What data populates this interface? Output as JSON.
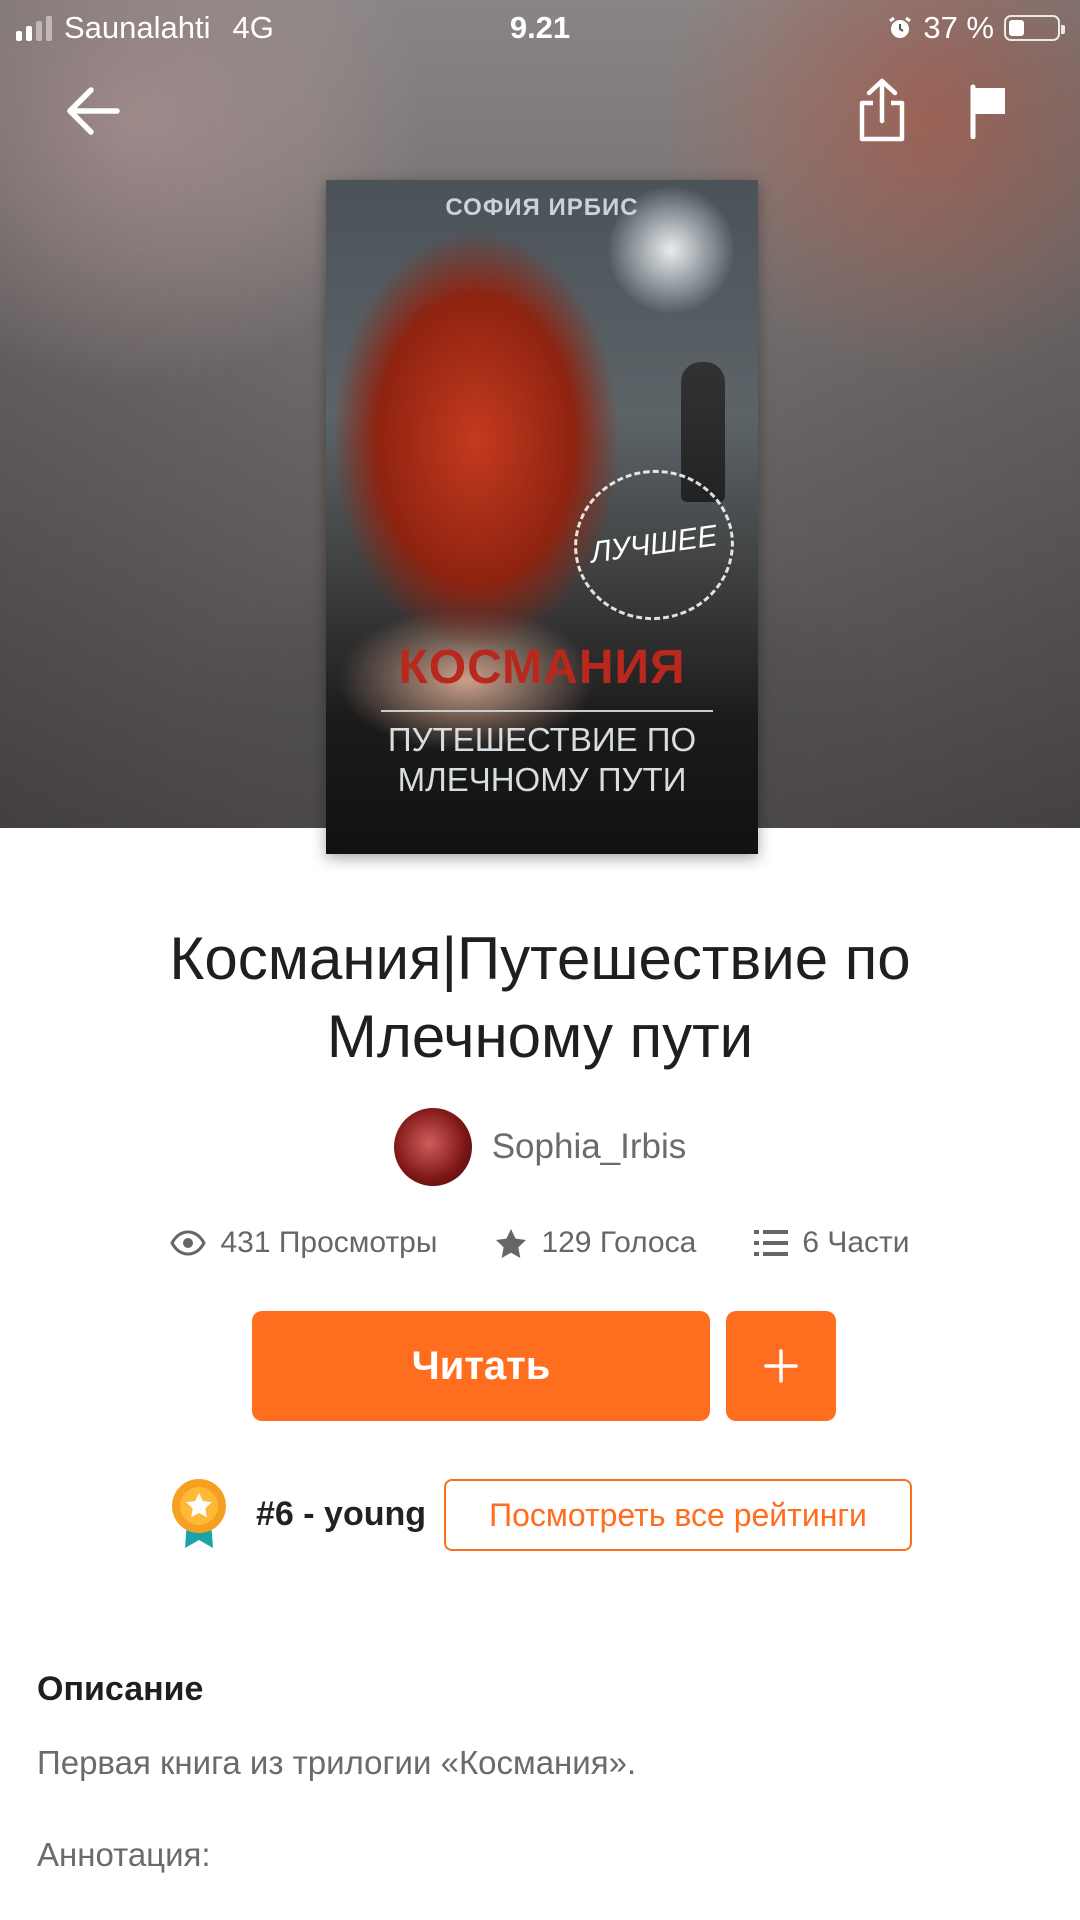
{
  "status_bar": {
    "carrier": "Saunalahti",
    "network": "4G",
    "time": "9.21",
    "battery_text": "37 %",
    "battery_level": 0.37
  },
  "nav": {
    "back_icon": "arrow-left-icon",
    "share_icon": "share-icon",
    "report_icon": "flag-icon"
  },
  "cover": {
    "author": "СОФИЯ ИРБИС",
    "badge": "ЛУЧШЕЕ",
    "title_line1": "КОСМАНИЯ",
    "title_line2": "ПУТЕШЕСТВИЕ ПО",
    "title_line3": "МЛЕЧНОМУ ПУТИ"
  },
  "book": {
    "title_line1": "Космания|Путешествие по",
    "title_line2": "Млечному пути",
    "author": "Sophia_Irbis"
  },
  "stats": {
    "views": "431 Просмотры",
    "votes": "129 Голоса",
    "parts": "6 Части"
  },
  "actions": {
    "read_label": "Читать",
    "add_icon": "plus-icon"
  },
  "ranking": {
    "rank_label": "#6 - young",
    "view_all_label": "Посмотреть все рейтинги"
  },
  "description": {
    "heading": "Описание",
    "text": "Первая книга из трилогии «Космания».",
    "text2": "Аннотация:"
  },
  "colors": {
    "accent": "#ff6d1f",
    "text_primary": "#1f1f1f",
    "text_secondary": "#6b6b6b"
  }
}
